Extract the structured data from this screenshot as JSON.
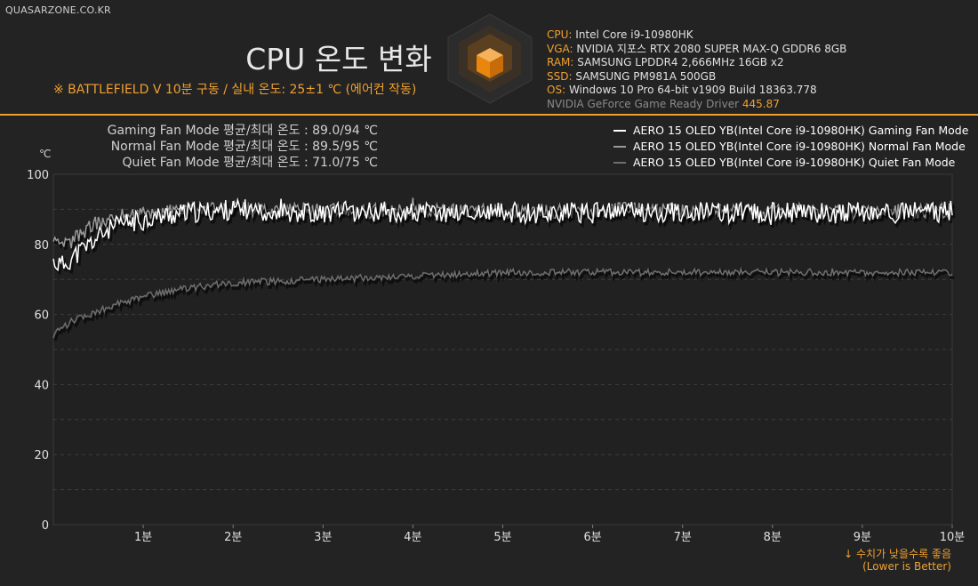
{
  "site": "QUASARZONE.CO.KR",
  "title": "CPU 온도 변화",
  "subtitle": "※ BATTLEFIELD V 10분 구동 / 실내 온도: 25±1 ℃ (에어컨 작동)",
  "specs": {
    "cpu_key": "CPU:",
    "cpu_val": "Intel Core i9-10980HK",
    "vga_key": "VGA:",
    "vga_val": "NVIDIA 지포스 RTX 2080 SUPER MAX-Q GDDR6 8GB",
    "ram_key": "RAM:",
    "ram_val": "SAMSUNG LPDDR4 2,666MHz 16GB x2",
    "ssd_key": "SSD:",
    "ssd_val": "SAMSUNG PM981A 500GB",
    "os_key": "OS:",
    "os_val": "Windows 10 Pro 64-bit v1909 Build 18363.778",
    "driver_text": "NVIDIA GeForce Game Ready Driver",
    "driver_ver": "445.87"
  },
  "stats": [
    "Gaming Fan Mode 평균/최대 온도 : 89.0/94 ℃",
    "Normal Fan Mode 평균/최대 온도 : 89.5/95 ℃",
    "Quiet Fan Mode 평균/최대 온도 : 71.0/75 ℃"
  ],
  "colors": {
    "accent": "#f0a030",
    "gaming": "#ffffff",
    "normal": "#9a9a9a",
    "quiet": "#6e6e6e",
    "background": "#232323"
  },
  "note": {
    "line1": "↓ 수치가 낮을수록 좋음",
    "line2": "(Lower is Better)"
  },
  "chart_data": {
    "type": "line",
    "ylabel": "℃",
    "ylim": [
      0,
      100
    ],
    "xlim": [
      0,
      10
    ],
    "yticks": [
      "0",
      "20",
      "40",
      "60",
      "80",
      "100"
    ],
    "xticks": [
      "1분",
      "2분",
      "3분",
      "4분",
      "5분",
      "6분",
      "7분",
      "8분",
      "9분",
      "10분"
    ],
    "grid": true,
    "legend_position": "top-right",
    "series": [
      {
        "name": "AERO 15 OLED YB(Intel Core i9-10980HK) Gaming Fan Mode",
        "color": "#ffffff",
        "x": [
          0,
          0.1,
          0.2,
          0.3,
          0.4,
          0.5,
          0.6,
          0.8,
          1.0,
          1.2,
          1.5,
          1.8,
          2.0,
          2.5,
          3.0,
          3.5,
          4.0,
          4.5,
          5.0,
          5.5,
          6.0,
          6.5,
          7.0,
          7.5,
          8.0,
          8.5,
          9.0,
          9.5,
          10.0
        ],
        "values": [
          75,
          74,
          76,
          78,
          80,
          82,
          84,
          86,
          87,
          88,
          89,
          89.5,
          90,
          89.5,
          89,
          89.5,
          89,
          89,
          89,
          89,
          89,
          89.5,
          89,
          89,
          89,
          89,
          89,
          89,
          89.5
        ],
        "peak": 94
      },
      {
        "name": "AERO 15 OLED YB(Intel Core i9-10980HK) Normal Fan Mode",
        "color": "#9a9a9a",
        "x": [
          0,
          0.1,
          0.2,
          0.3,
          0.4,
          0.5,
          0.6,
          0.8,
          1.0,
          1.2,
          1.5,
          1.8,
          2.0,
          2.5,
          3.0,
          3.5,
          4.0,
          4.5,
          5.0,
          5.5,
          6.0,
          6.5,
          7.0,
          7.5,
          8.0,
          8.5,
          9.0,
          9.5,
          10.0
        ],
        "values": [
          80,
          79,
          81,
          83,
          85,
          86,
          87,
          88.5,
          89,
          89.5,
          90,
          90,
          90,
          90,
          89.5,
          89.5,
          89.5,
          89.5,
          89.5,
          89.5,
          89.5,
          90,
          89.5,
          89.5,
          89.5,
          89.5,
          89.5,
          89.5,
          89.5
        ],
        "peak": 95
      },
      {
        "name": "AERO 15 OLED YB(Intel Core i9-10980HK) Quiet Fan Mode",
        "color": "#6e6e6e",
        "x": [
          0,
          0.1,
          0.2,
          0.3,
          0.4,
          0.5,
          0.6,
          0.8,
          1.0,
          1.2,
          1.5,
          1.8,
          2.0,
          2.5,
          3.0,
          3.5,
          4.0,
          4.5,
          5.0,
          5.5,
          6.0,
          6.5,
          7.0,
          7.5,
          8.0,
          8.5,
          9.0,
          9.5,
          10.0
        ],
        "values": [
          54,
          56,
          58,
          59,
          60,
          61,
          62,
          63.5,
          65,
          66,
          67.5,
          68.5,
          69,
          69.5,
          70,
          70.5,
          71,
          71.5,
          72,
          72,
          72,
          72,
          72,
          72,
          72,
          72,
          72,
          72,
          72
        ],
        "peak": 75
      }
    ]
  }
}
